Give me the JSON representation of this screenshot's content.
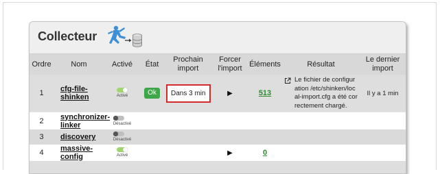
{
  "panel": {
    "title": "Collecteur"
  },
  "columns": {
    "order": "Ordre",
    "name": "Nom",
    "enabled": "Activé",
    "state": "État",
    "next_import": "Prochain import",
    "force_import": "Forcer l'import",
    "elements": "Éléments",
    "result": "Résultat",
    "last_import": "Le dernier import"
  },
  "rows": [
    {
      "order": "1",
      "name": "cfg-file-shinken",
      "enabled_label": "Activé",
      "enabled": true,
      "state": "Ok",
      "next_import": "Dans 3 min",
      "force_import_icon": "play-icon",
      "elements": "513",
      "result": "Le fichier de configuration /etc/shinken/local-import.cfg a été correctement chargé.",
      "last_import": "Il y a 1 min"
    },
    {
      "order": "2",
      "name": "synchronizer-linker",
      "enabled_label": "Désactivé",
      "enabled": false
    },
    {
      "order": "3",
      "name": "discovery",
      "enabled_label": "Désactivé",
      "enabled": false
    },
    {
      "order": "4",
      "name": "massive-config",
      "enabled_label": "Activé",
      "enabled": true,
      "force_import_icon": "play-icon",
      "elements": "0"
    }
  ],
  "colors": {
    "ok": "#3fa64a",
    "highlight_border": "#d42a2a",
    "count_link": "#2e8b2e",
    "toggle_on": "#9fd66f"
  }
}
